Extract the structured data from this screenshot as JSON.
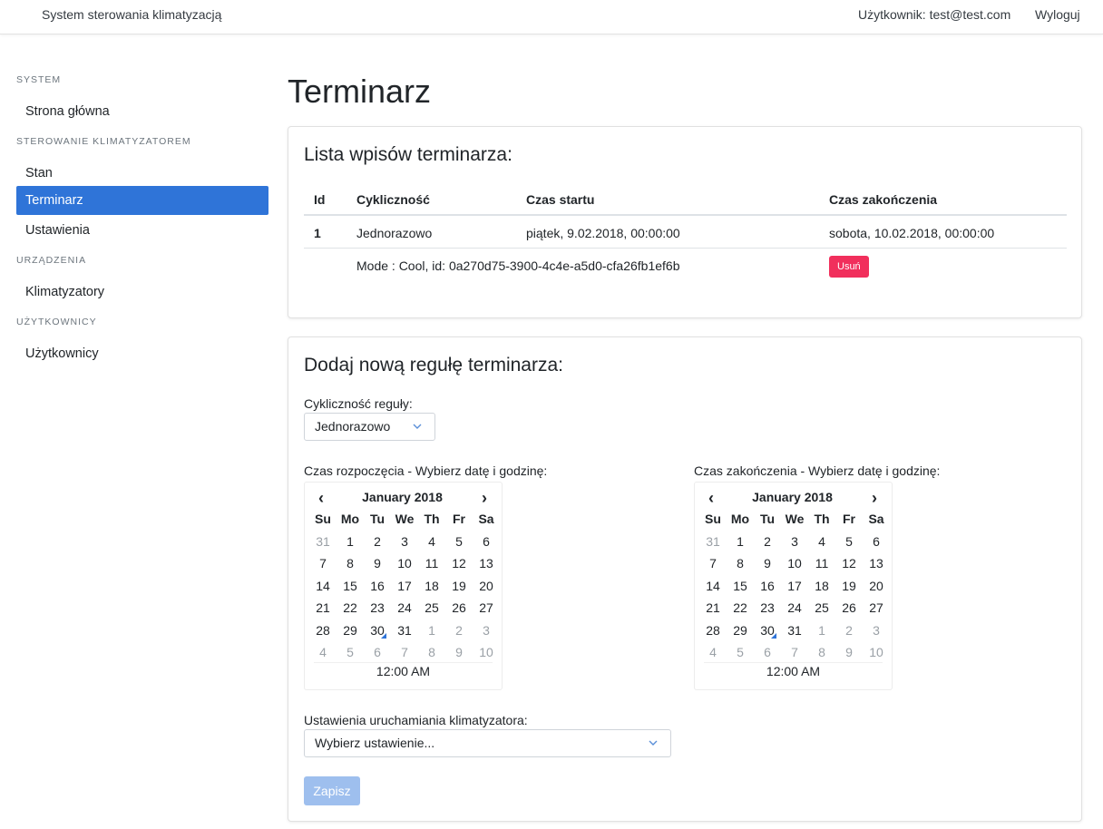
{
  "header": {
    "app_title": "System sterowania klimatyzacją",
    "user_label": "Użytkownik: test@test.com",
    "logout_label": "Wyloguj"
  },
  "sidebar": {
    "sections": [
      {
        "heading": "SYSTEM",
        "items": [
          {
            "label": "Strona główna",
            "active": false
          }
        ]
      },
      {
        "heading": "STEROWANIE KLIMATYZATOREM",
        "items": [
          {
            "label": "Stan",
            "active": false
          },
          {
            "label": "Terminarz",
            "active": true
          },
          {
            "label": "Ustawienia",
            "active": false
          }
        ]
      },
      {
        "heading": "URZĄDZENIA",
        "items": [
          {
            "label": "Klimatyzatory",
            "active": false
          }
        ]
      },
      {
        "heading": "UŻYTKOWNICY",
        "items": [
          {
            "label": "Użytkownicy",
            "active": false
          }
        ]
      }
    ]
  },
  "main": {
    "page_title": "Terminarz",
    "list_card": {
      "title": "Lista wpisów terminarza:",
      "columns": [
        "Id",
        "Cykliczność",
        "Czas startu",
        "Czas zakończenia"
      ],
      "rows": [
        {
          "id": "1",
          "cycle": "Jednorazowo",
          "start": "piątek, 9.02.2018, 00:00:00",
          "end": "sobota, 10.02.2018, 00:00:00",
          "detail": "Mode : Cool, id: 0a270d75-3900-4c4e-a5d0-cfa26fb1ef6b",
          "delete_label": "Usuń"
        }
      ]
    },
    "form_card": {
      "title": "Dodaj nową regułę terminarza:",
      "cycle_label": "Cykliczność reguły:",
      "cycle_value": "Jednorazowo",
      "start_label": "Czas rozpoczęcia - Wybierz datę i godzinę:",
      "end_label": "Czas zakończenia - Wybierz datę i godzinę:",
      "settings_label": "Ustawienia uruchamiania klimatyzatora:",
      "settings_value": "Wybierz ustawienie...",
      "save_label": "Zapisz"
    },
    "calendar": {
      "prev_glyph": "‹",
      "next_glyph": "›",
      "month_label": "January 2018",
      "weekdays": [
        "Su",
        "Mo",
        "Tu",
        "We",
        "Th",
        "Fr",
        "Sa"
      ],
      "weeks": [
        [
          "31",
          "1",
          "2",
          "3",
          "4",
          "5",
          "6"
        ],
        [
          "7",
          "8",
          "9",
          "10",
          "11",
          "12",
          "13"
        ],
        [
          "14",
          "15",
          "16",
          "17",
          "18",
          "19",
          "20"
        ],
        [
          "21",
          "22",
          "23",
          "24",
          "25",
          "26",
          "27"
        ],
        [
          "28",
          "29",
          "30",
          "31",
          "1",
          "2",
          "3"
        ],
        [
          "4",
          "5",
          "6",
          "7",
          "8",
          "9",
          "10"
        ]
      ],
      "time_label": "12:00 AM"
    }
  },
  "colors": {
    "accent": "#2f74d8",
    "danger": "#f12f5c",
    "disabled_button": "#9ebfee"
  }
}
